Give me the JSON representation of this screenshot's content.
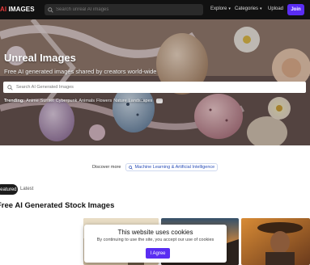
{
  "header": {
    "logo_prefix": "AI",
    "logo_suffix": " IMAGES",
    "search_placeholder": "Search unreal AI images",
    "nav": [
      {
        "label": "Explore"
      },
      {
        "label": "Categories"
      },
      {
        "label": "Upload"
      }
    ],
    "join_label": "Join"
  },
  "hero": {
    "title": "Unreal Images",
    "subtitle": "Free AI generated images shared by creators world-wide",
    "search_placeholder": "Search AI Generated Images",
    "trending_label": "Trending:",
    "trending_tags": [
      "Anime",
      "Sunset",
      "Cyberpunk",
      "Animals",
      "Flowers",
      "Nature",
      "Landscapes"
    ],
    "more_label": "···"
  },
  "discover": {
    "label": "Discover more",
    "chip_label": "Machine Learning & Artificial Intelligence"
  },
  "tabs": {
    "active": "Featured",
    "other": "Latest"
  },
  "section_title": "Free AI Generated Stock Images",
  "cookie": {
    "title": "This website uses cookies",
    "text": "By continuing to use the site, you accept our use of cookies",
    "button": "I Agree"
  },
  "colors": {
    "accent": "#5a2df2",
    "logo_red": "#e63a3a",
    "topbar": "#111111"
  }
}
